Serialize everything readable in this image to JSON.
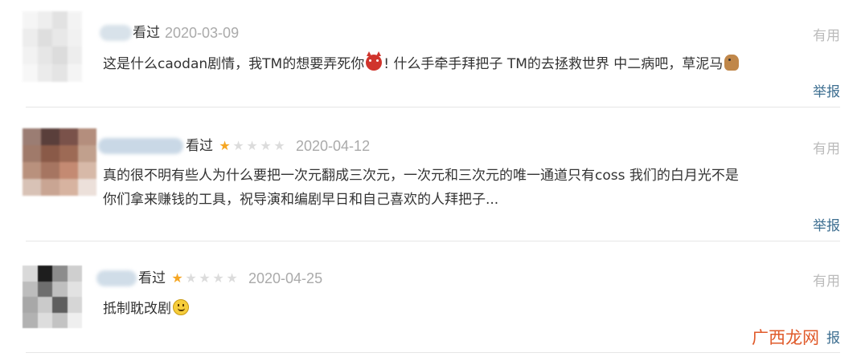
{
  "comments": [
    {
      "seen_label": "看过",
      "date": "2020-03-09",
      "useful_label": "有用",
      "report_label": "举报",
      "text_part1": "这是什么caodan剧情，我TM的想要弄死你",
      "text_part2": "! 什么手牵手拜把子 TM的去拯救世界 中二病吧，草泥马",
      "emoji1": "devil-face-icon",
      "emoji2": "horse-icon"
    },
    {
      "seen_label": "看过",
      "rating": "1/5",
      "date": "2020-04-12",
      "useful_label": "有用",
      "report_label": "举报",
      "text_line1": "真的很不明有些人为什么要把一次元翻成三次元，一次元和三次元的唯一通道只有coss 我们的白月光不是",
      "text_line2": "你们拿来赚钱的工具，祝导演和编剧早日和自己喜欢的人拜把子..."
    },
    {
      "seen_label": "看过",
      "rating": "1/5",
      "date": "2020-04-25",
      "useful_label": "有用",
      "text": "抵制耽改剧",
      "emoji": "smile-icon",
      "report_partial": "报"
    }
  ],
  "star_icon": "star-icon",
  "colors": {
    "star_on": "#f5a623",
    "star_off": "#dcdcdc",
    "report_link": "#3e6f91",
    "watermark": "#e05a2a"
  },
  "watermark": "广西龙网"
}
